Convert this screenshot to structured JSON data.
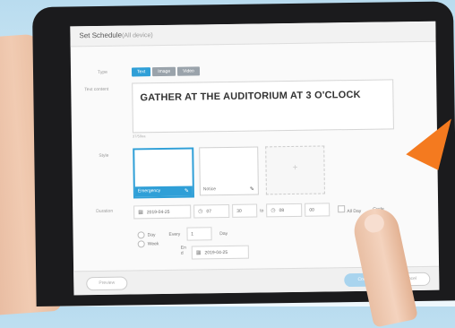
{
  "dialog": {
    "title": "Set Schedule",
    "title_sub": "(All device)"
  },
  "form": {
    "type_label": "Type",
    "type_tabs": [
      {
        "label": "Text",
        "active": true
      },
      {
        "label": "Image",
        "active": false
      },
      {
        "label": "Video",
        "active": false
      }
    ],
    "text_content_label": "Text content",
    "text_content_value": "GATHER AT THE AUDITORIUM AT 3 O'CLOCK",
    "char_counter": "37/50ea",
    "style_label": "Style",
    "style_options": [
      {
        "label": "Emergency",
        "selected": true
      },
      {
        "label": "Notice",
        "selected": false
      }
    ],
    "duration_label": "Duration",
    "start_date": "2019-04-25",
    "start_hour": "07",
    "start_min": "30",
    "to_label": "to",
    "end_hour": "08",
    "end_min": "00",
    "all_day_label": "All Day",
    "recycle_label": "Cycle",
    "repeat_options": [
      "Day",
      "Week"
    ],
    "every_label": "Every",
    "every_value": "1",
    "every_unit": "Day",
    "end_label_1": "En",
    "end_label_2": "d",
    "end_date": "2019-04-25"
  },
  "footer": {
    "preview_label": "Preview",
    "confirm_label": "Confirm",
    "cancel_label": "Cancel"
  },
  "colors": {
    "accent": "#2f9fd7",
    "arrow": "#f47a1f"
  }
}
